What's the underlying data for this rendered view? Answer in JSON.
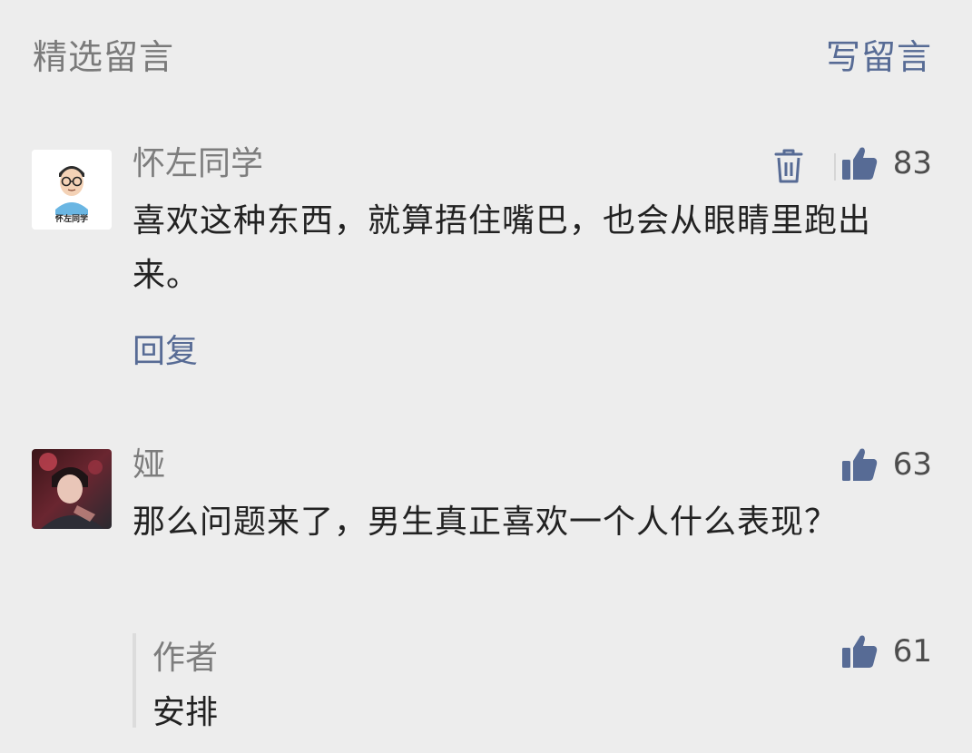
{
  "header": {
    "title": "精选留言",
    "write_label": "写留言"
  },
  "comments": [
    {
      "nickname": "怀左同学",
      "avatar_caption": "怀左同学",
      "content": "喜欢这种东西，就算捂住嘴巴，也会从眼睛里跑出来。",
      "like_count": "83",
      "reply_label": "回复",
      "has_delete": true
    },
    {
      "nickname": "娅",
      "content": "那么问题来了，男生真正喜欢一个人什么表现？",
      "like_count": "63",
      "author_reply": {
        "label": "作者",
        "content": "安排",
        "like_count": "61"
      }
    }
  ],
  "colors": {
    "background": "#ededed",
    "link": "#576b95",
    "muted": "#7d7d7d",
    "text": "#222222"
  },
  "icons": {
    "like": "thumbs-up-icon",
    "delete": "trash-icon"
  }
}
